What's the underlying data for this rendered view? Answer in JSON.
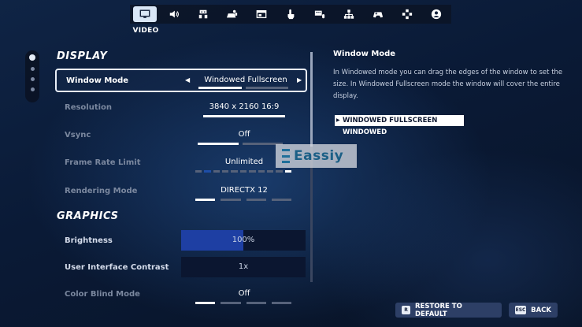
{
  "nav": {
    "tabs": [
      {
        "icon": "monitor-icon",
        "active": true
      },
      {
        "icon": "speaker-icon"
      },
      {
        "icon": "accessibility-icon"
      },
      {
        "icon": "controller-touch-icon"
      },
      {
        "icon": "window-icon"
      },
      {
        "icon": "touch-hand-icon"
      },
      {
        "icon": "keyboard-mouse-icon"
      },
      {
        "icon": "network-icon"
      },
      {
        "icon": "gamepad-icon"
      },
      {
        "icon": "dpad-icon"
      },
      {
        "icon": "account-icon"
      }
    ],
    "active_caption": "VIDEO"
  },
  "sections": {
    "display_title": "DISPLAY",
    "graphics_title": "GRAPHICS"
  },
  "settings": {
    "window_mode": {
      "label": "Window Mode",
      "value": "Windowed Fullscreen"
    },
    "resolution": {
      "label": "Resolution",
      "value": "3840 x 2160 16:9"
    },
    "vsync": {
      "label": "Vsync",
      "value": "Off"
    },
    "frame_rate_limit": {
      "label": "Frame Rate Limit",
      "value": "Unlimited"
    },
    "rendering_mode": {
      "label": "Rendering Mode",
      "value": "DIRECTX 12"
    },
    "brightness": {
      "label": "Brightness",
      "value": "100%",
      "level": 0.5
    },
    "ui_contrast": {
      "label": "User Interface Contrast",
      "value": "1x"
    },
    "color_blind_mode": {
      "label": "Color Blind Mode",
      "value": "Off"
    }
  },
  "help": {
    "title": "Window Mode",
    "text": "In Windowed mode you can drag the edges of the window to set the size. In Windowed Fullscreen mode the window will cover the entire display.",
    "options": [
      {
        "label": "WINDOWED FULLSCREEN",
        "selected": true
      },
      {
        "label": "WINDOWED",
        "selected": false
      }
    ]
  },
  "watermark": {
    "text": "Eassiy"
  },
  "footer": {
    "restore_key": "R",
    "restore_label": "RESTORE TO DEFAULT",
    "back_key": "ESC",
    "back_label": "BACK"
  },
  "colors": {
    "accent_blue": "#1e3fa3",
    "focus_border": "#e8eef8",
    "button_bg": "#2d3f66"
  }
}
